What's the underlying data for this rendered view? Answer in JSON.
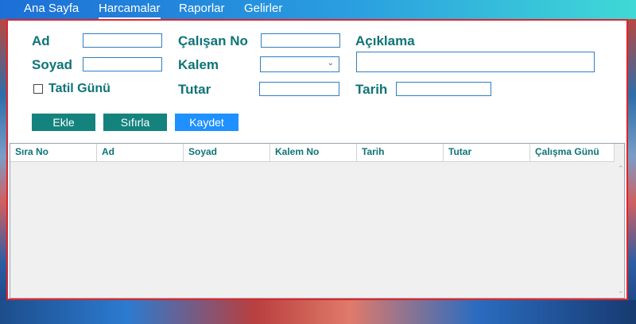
{
  "nav": {
    "items": [
      {
        "label": "Ana Sayfa"
      },
      {
        "label": "Harcamalar"
      },
      {
        "label": "Raporlar"
      },
      {
        "label": "Gelirler"
      }
    ],
    "active": "Harcamalar"
  },
  "form": {
    "ad_label": "Ad",
    "soyad_label": "Soyad",
    "tatil_label": "Tatil Günü",
    "calisan_label": "Çalışan No",
    "kalem_label": "Kalem",
    "tutar_label": "Tutar",
    "aciklama_label": "Açıklama",
    "tarih_label": "Tarih"
  },
  "buttons": {
    "ekle": "Ekle",
    "sifirla": "Sıfırla",
    "kaydet": "Kaydet"
  },
  "grid": {
    "columns": [
      "Sıra No",
      "Ad",
      "Soyad",
      "Kalem No",
      "Tarih",
      "Tutar",
      "Çalışma Günü"
    ]
  },
  "colors": {
    "label": "#0e7478",
    "panel_border": "#e0242c",
    "button_teal": "#14837e",
    "button_blue": "#1e90ff"
  },
  "icons": {
    "dropdown": "chevron-down-icon",
    "scroll_up": "chevron-up-icon",
    "scroll_down": "chevron-down-icon"
  }
}
